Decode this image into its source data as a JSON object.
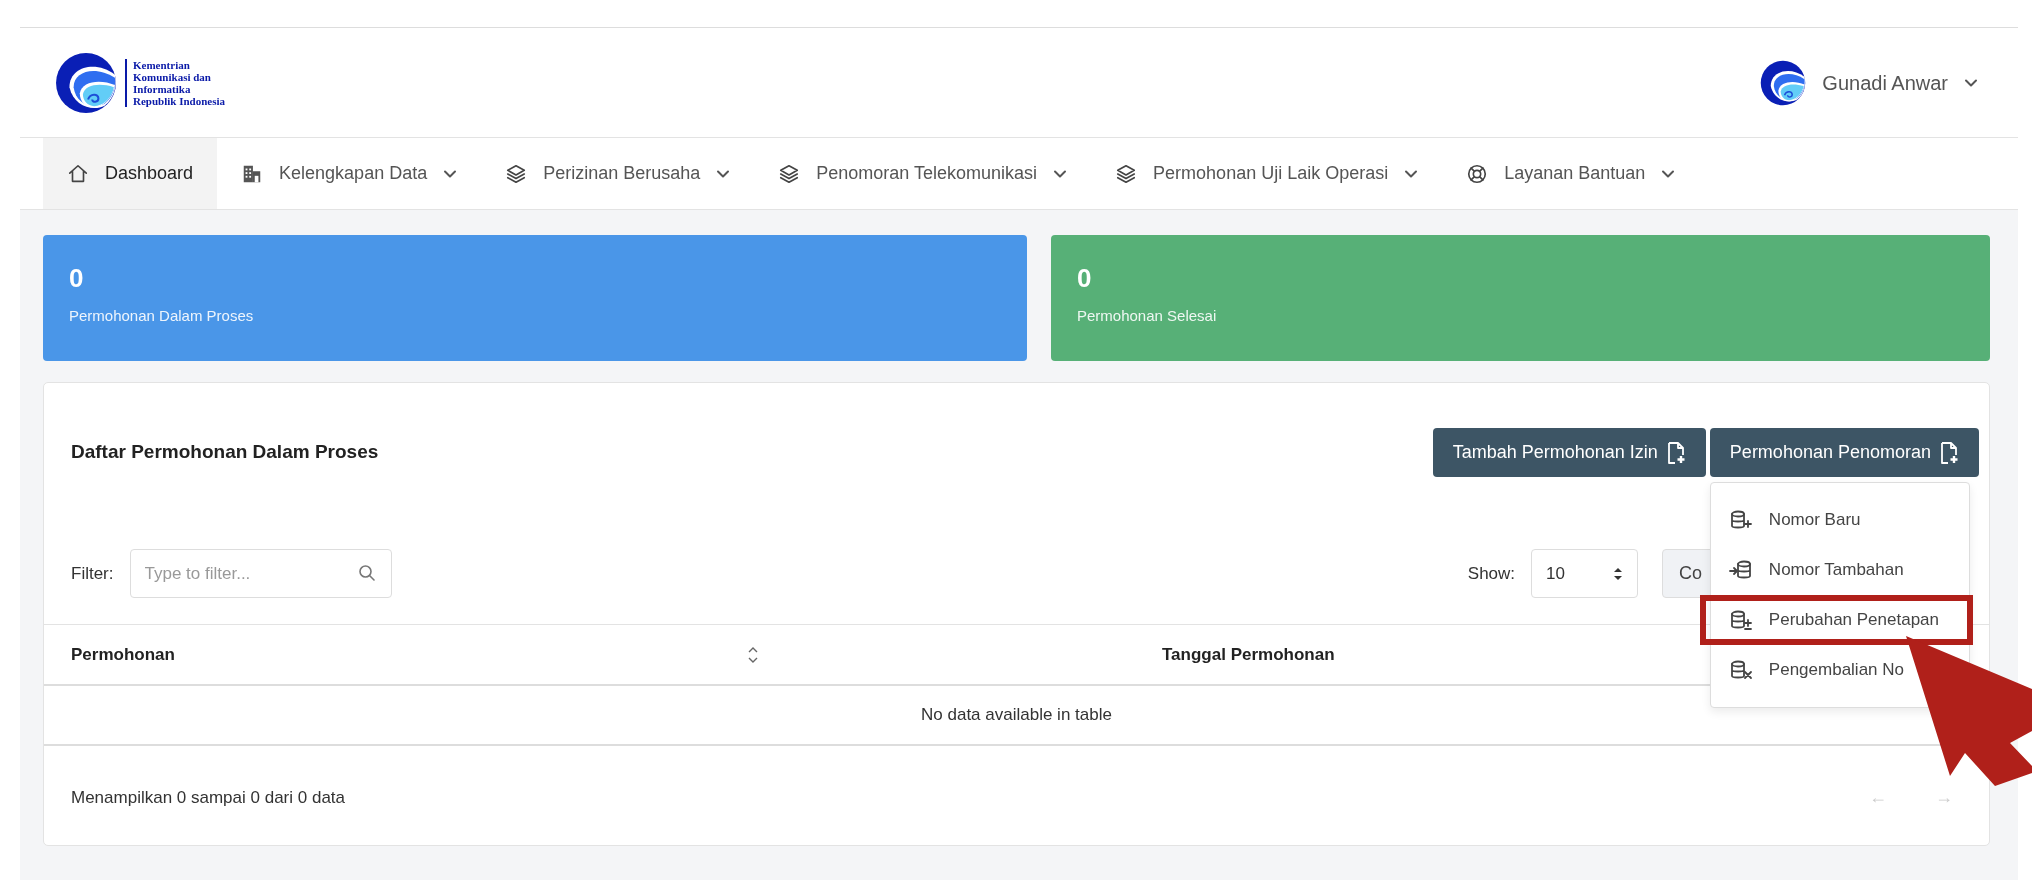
{
  "header": {
    "logo_text": [
      "Kementrian",
      "Komunikasi dan",
      "Informatika",
      "Republik Indonesia"
    ],
    "user": {
      "name": "Gunadi Anwar"
    }
  },
  "nav": [
    {
      "label": "Dashboard",
      "kind": "home",
      "selected": true,
      "dropdown": false
    },
    {
      "label": "Kelengkapan Data",
      "kind": "building",
      "selected": false,
      "dropdown": true
    },
    {
      "label": "Perizinan Berusaha",
      "kind": "layers",
      "selected": false,
      "dropdown": true
    },
    {
      "label": "Penomoran Telekomunikasi",
      "kind": "layers",
      "selected": false,
      "dropdown": true
    },
    {
      "label": "Permohonan Uji Laik Operasi",
      "kind": "layers",
      "selected": false,
      "dropdown": true
    },
    {
      "label": "Layanan Bantuan",
      "kind": "lifebuoy",
      "selected": false,
      "dropdown": true
    }
  ],
  "stats": [
    {
      "value": "0",
      "label": "Permohonan Dalam Proses",
      "color": "#4a96e8"
    },
    {
      "value": "0",
      "label": "Permohonan Selesai",
      "color": "#57b077"
    }
  ],
  "panel": {
    "title": "Daftar Permohonan Dalam Proses",
    "buttons": [
      {
        "label": "Tambah Permohonan Izin"
      },
      {
        "label": "Permohonan Penomoran",
        "expanded": true
      }
    ],
    "menu": [
      {
        "label": "Nomor Baru",
        "kind": "add",
        "highlighted": false
      },
      {
        "label": "Nomor Tambahan",
        "kind": "append",
        "highlighted": false
      },
      {
        "label": "Perubahan Penetapan",
        "kind": "change",
        "highlighted": true
      },
      {
        "label": "Pengembalian No",
        "kind": "return",
        "highlighted": false
      }
    ],
    "filter": {
      "label": "Filter:",
      "placeholder": "Type to filter..."
    },
    "show": {
      "label": "Show:",
      "value": "10"
    },
    "covered_button": "Co",
    "table": {
      "columns": [
        {
          "label": "Permohonan",
          "sortable": true
        },
        {
          "label": "Tanggal Permohonan",
          "sortable": false
        }
      ],
      "empty_text": "No data available in table"
    },
    "footer": {
      "info": "Menampilkan 0 sampai 0 dari 0 data",
      "pager": [
        "←",
        "→"
      ]
    }
  }
}
